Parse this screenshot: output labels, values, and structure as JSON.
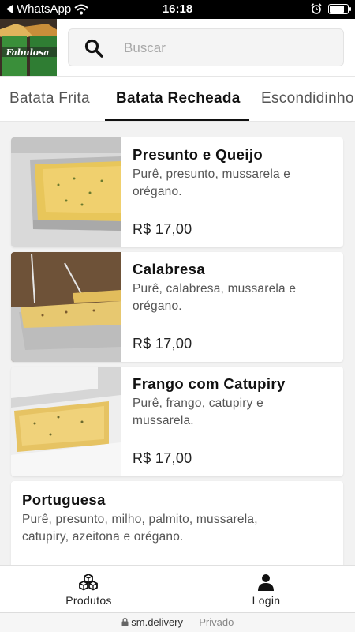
{
  "status_bar": {
    "back_label": "WhatsApp",
    "time": "16:18",
    "battery_level": 0.85
  },
  "header": {
    "logo_text": "Fabulosa",
    "search_placeholder": "Buscar"
  },
  "tabs": [
    {
      "label": "Batata Frita",
      "active": false
    },
    {
      "label": "Batata Recheada",
      "active": true
    },
    {
      "label": "Escondidinho",
      "active": false
    }
  ],
  "products": [
    {
      "name": "Presunto e Queijo",
      "description_lines": [
        "Purê, presunto, mussarela e",
        "orégano."
      ],
      "price": "R$ 17,00",
      "has_image": true
    },
    {
      "name": "Calabresa",
      "description_lines": [
        "Purê, calabresa, mussarela e",
        "orégano."
      ],
      "price": "R$ 17,00",
      "has_image": true
    },
    {
      "name": "Frango com Catupiry",
      "description_lines": [
        "Purê, frango, catupiry e",
        "mussarela."
      ],
      "price": "R$ 17,00",
      "has_image": true
    },
    {
      "name": "Portuguesa",
      "description_lines": [
        "Purê, presunto, milho, palmito, mussarela,",
        "catupiry, azeitona e orégano."
      ],
      "price": "",
      "has_image": false
    }
  ],
  "bottom_nav": [
    {
      "label": "Produtos",
      "icon": "cubes-icon"
    },
    {
      "label": "Login",
      "icon": "user-icon"
    }
  ],
  "url_bar": {
    "domain": "sm.delivery",
    "separator": "—",
    "mode": "Privado"
  }
}
